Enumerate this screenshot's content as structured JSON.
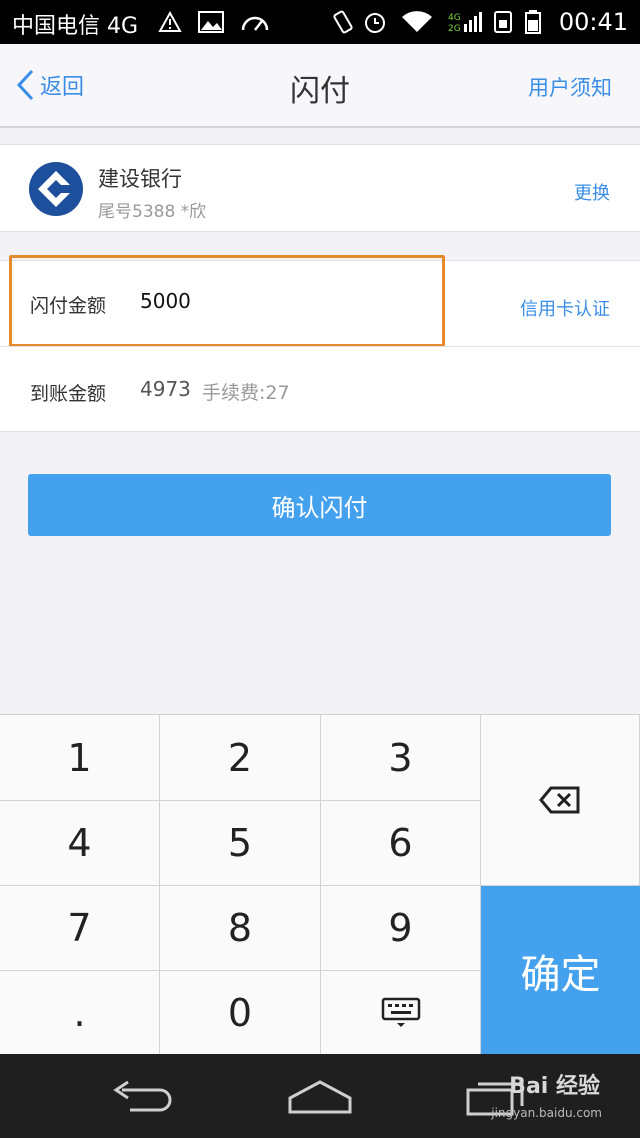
{
  "status_bar": {
    "carrier": "中国电信 4G",
    "time": "00:41"
  },
  "nav": {
    "back_label": "返回",
    "title": "闪付",
    "notice_label": "用户须知"
  },
  "bank": {
    "name": "建设银行",
    "detail": "尾号5388  *欣",
    "change_label": "更换"
  },
  "amount": {
    "label": "闪付金额",
    "value": "5000",
    "credit_auth_label": "信用卡认证"
  },
  "arrival": {
    "label": "到账金额",
    "value": "4973",
    "fee": "手续费:27"
  },
  "confirm_button": "确认闪付",
  "keypad": {
    "keys": [
      "1",
      "2",
      "3",
      "4",
      "5",
      "6",
      "7",
      "8",
      "9",
      ".",
      "0"
    ],
    "ok_label": "确定"
  },
  "watermark": {
    "brand": "Bai 经验",
    "url": "jingyan.baidu.com"
  },
  "colors": {
    "accent": "#3a8ee6",
    "button": "#44a1ee",
    "highlight_border": "#e68a2e"
  }
}
